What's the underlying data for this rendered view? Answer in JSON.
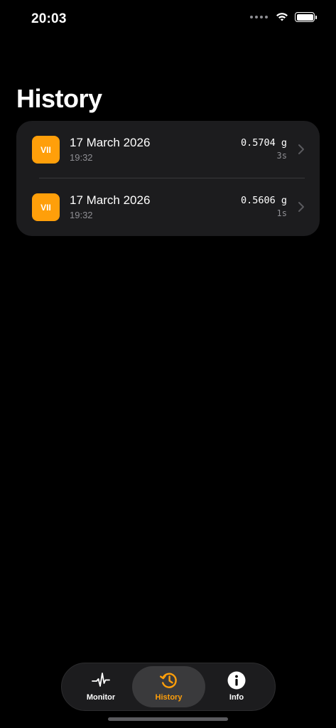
{
  "status_bar": {
    "time": "20:03",
    "icons": [
      "cellular-dots-icon",
      "wifi-icon",
      "battery-icon"
    ]
  },
  "page": {
    "title": "History"
  },
  "history": {
    "items": [
      {
        "badge": "VII",
        "date": "17 March 2026",
        "time": "19:32",
        "value": "0.5704 g",
        "duration": "3s"
      },
      {
        "badge": "VII",
        "date": "17 March 2026",
        "time": "19:32",
        "value": "0.5606 g",
        "duration": "1s"
      }
    ]
  },
  "tab_bar": {
    "tabs": [
      {
        "label": "Monitor",
        "icon": "waveform-icon",
        "selected": false
      },
      {
        "label": "History",
        "icon": "clock-history-icon",
        "selected": true
      },
      {
        "label": "Info",
        "icon": "info-icon",
        "selected": false
      }
    ]
  },
  "colors": {
    "accent": "#ff9f0a",
    "background": "#000000",
    "card": "#1c1c1e",
    "secondary_text": "#8e8e93"
  }
}
